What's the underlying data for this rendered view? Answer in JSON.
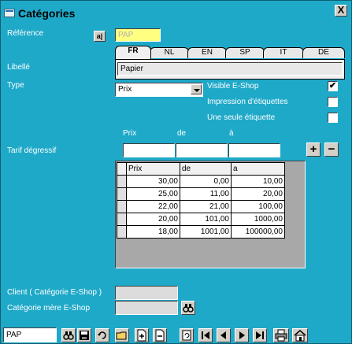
{
  "window": {
    "title": "Catégories",
    "close": "X"
  },
  "form": {
    "reference_label": "Référence",
    "reference_value": "PAP",
    "reference_button": "a|",
    "libelle_label": "Libellé",
    "libelle_value": "Papier",
    "type_label": "Type",
    "type_value": "Prix",
    "tarif_label": "Tarif dégressif",
    "col_prix": "Prix",
    "col_de": "de",
    "col_a": "à",
    "client_label": "Client ( Catégorie E-Shop )",
    "categorie_mere_label": "Catégorie mère E-Shop"
  },
  "tabs": [
    {
      "label": "FR",
      "active": true
    },
    {
      "label": "NL",
      "active": false
    },
    {
      "label": "EN",
      "active": false
    },
    {
      "label": "SP",
      "active": false
    },
    {
      "label": "IT",
      "active": false
    },
    {
      "label": "DE",
      "active": false
    }
  ],
  "checkboxes": [
    {
      "label": "Visible E-Shop",
      "checked": true,
      "mark": "✔"
    },
    {
      "label": "Impression d'étiquettes",
      "checked": false,
      "mark": ""
    },
    {
      "label": "Une seule étiquette",
      "checked": false,
      "mark": ""
    }
  ],
  "buttons": {
    "plus": "+",
    "minus": "−"
  },
  "grid": {
    "headers": [
      "Prix",
      "de",
      "a"
    ],
    "rows": [
      [
        "30,00",
        "0,00",
        "10,00"
      ],
      [
        "25,00",
        "11,00",
        "20,00"
      ],
      [
        "22,00",
        "21,00",
        "100,00"
      ],
      [
        "20,00",
        "101,00",
        "1000,00"
      ],
      [
        "18,00",
        "1001,00",
        "100000,00"
      ]
    ]
  },
  "toolbar": {
    "nav_value": "PAP",
    "icons": [
      "binoculars-icon",
      "save-icon",
      "undo-icon",
      "open-folder-icon",
      "new-record-icon",
      "delete-record-icon",
      "refresh-icon",
      "first-record-icon",
      "previous-record-icon",
      "next-record-icon",
      "last-record-icon",
      "print-icon",
      "home-icon"
    ]
  },
  "colors": {
    "background": "#1fa9c9",
    "reference_field": "#ffff80"
  }
}
